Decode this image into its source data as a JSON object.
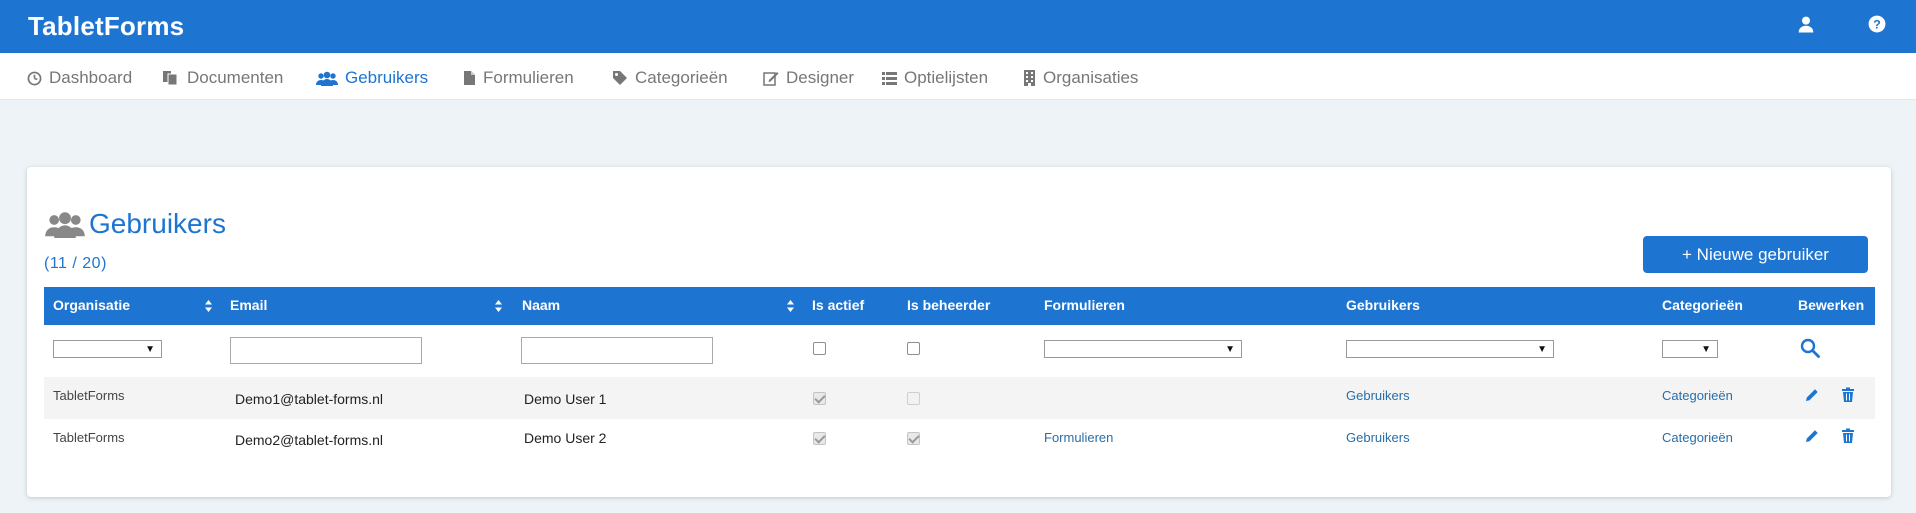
{
  "app": {
    "title": "TabletForms"
  },
  "nav": {
    "items": [
      {
        "label": "Dashboard",
        "icon": "dashboard-icon"
      },
      {
        "label": "Documenten",
        "icon": "documents-icon"
      },
      {
        "label": "Gebruikers",
        "icon": "users-icon",
        "active": true
      },
      {
        "label": "Formulieren",
        "icon": "file-icon"
      },
      {
        "label": "Categorieën",
        "icon": "tag-icon"
      },
      {
        "label": "Designer",
        "icon": "edit-icon"
      },
      {
        "label": "Optielijsten",
        "icon": "list-icon"
      },
      {
        "label": "Organisaties",
        "icon": "building-icon"
      }
    ]
  },
  "page": {
    "title": "Gebruikers",
    "count": "(11 / 20)",
    "new_button": "+ Nieuwe gebruiker"
  },
  "table": {
    "columns": [
      "Organisatie",
      "Email",
      "Naam",
      "Is actief",
      "Is beheerder",
      "Formulieren",
      "Gebruikers",
      "Categorieën",
      "Bewerken"
    ],
    "rows": [
      {
        "organisatie": "TabletForms",
        "email": "Demo1@tablet-forms.nl",
        "naam": "Demo User 1",
        "is_actief": true,
        "is_beheerder": false,
        "formulieren": "",
        "gebruikers": "Gebruikers",
        "categorieen": "Categorieën"
      },
      {
        "organisatie": "TabletForms",
        "email": "Demo2@tablet-forms.nl",
        "naam": "Demo User 2",
        "is_actief": true,
        "is_beheerder": true,
        "formulieren": "Formulieren",
        "gebruikers": "Gebruikers",
        "categorieen": "Categorieën"
      }
    ]
  },
  "colors": {
    "primary": "#1d75d1",
    "background": "#edf3f6",
    "link": "#286ea8"
  }
}
